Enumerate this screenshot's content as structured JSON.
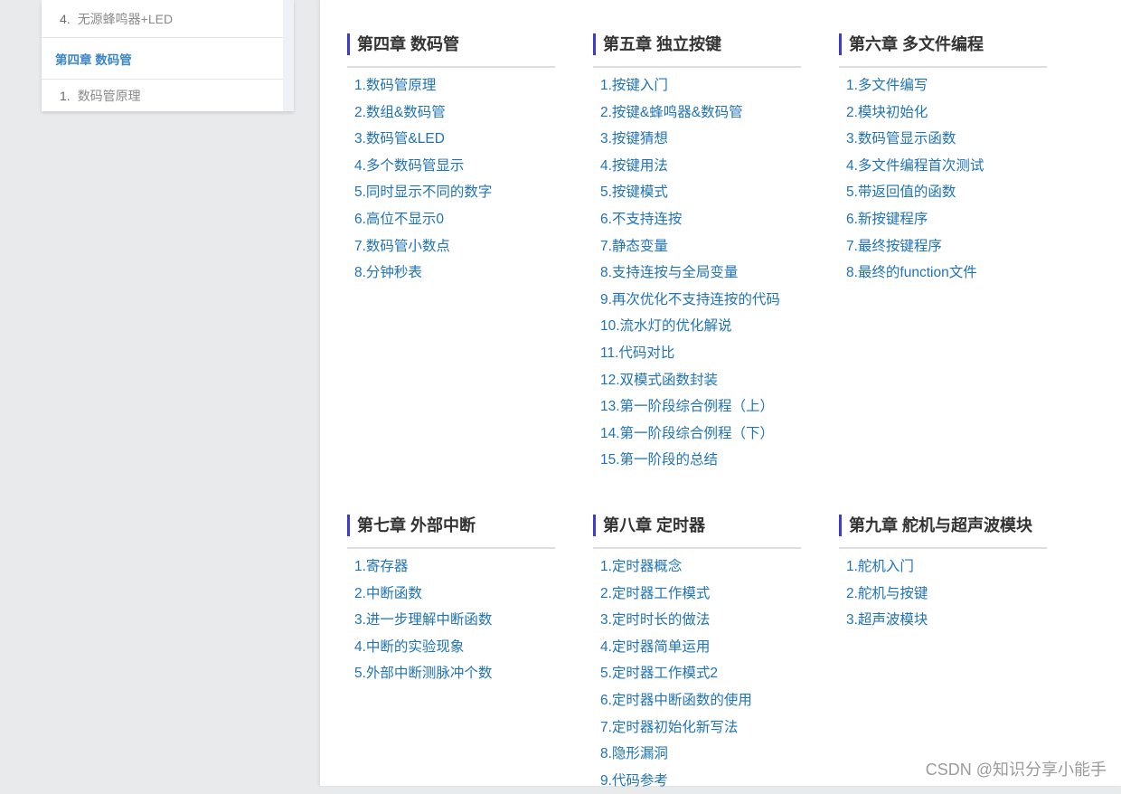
{
  "sidebar": {
    "items": [
      {
        "num": "4.",
        "label": "无源蜂鸣器+LED"
      },
      {
        "section": "第四章 数码管"
      },
      {
        "num": "1.",
        "label": "数码管原理"
      }
    ]
  },
  "chapters": [
    {
      "title": "第四章 数码管",
      "items": [
        "1.数码管原理",
        "2.数组&数码管",
        "3.数码管&LED",
        "4.多个数码管显示",
        "5.同时显示不同的数字",
        "6.高位不显示0",
        "7.数码管小数点",
        "8.分钟秒表"
      ]
    },
    {
      "title": "第五章 独立按键",
      "items": [
        "1.按键入门",
        "2.按键&蜂鸣器&数码管",
        "3.按键猜想",
        "4.按键用法",
        "5.按键模式",
        "6.不支持连按",
        "7.静态变量",
        "8.支持连按与全局变量",
        "9.再次优化不支持连按的代码",
        "10.流水灯的优化解说",
        "11.代码对比",
        "12.双模式函数封装",
        "13.第一阶段综合例程（上）",
        "14.第一阶段综合例程（下）",
        "15.第一阶段的总结"
      ]
    },
    {
      "title": "第六章 多文件编程",
      "items": [
        "1.多文件编写",
        "2.模块初始化",
        "3.数码管显示函数",
        "4.多文件编程首次测试",
        "5.带返回值的函数",
        "6.新按键程序",
        "7.最终按键程序",
        "8.最终的function文件"
      ]
    },
    {
      "title": "第七章 外部中断",
      "items": [
        "1.寄存器",
        "2.中断函数",
        "3.进一步理解中断函数",
        "4.中断的实验现象",
        "5.外部中断测脉冲个数"
      ]
    },
    {
      "title": "第八章 定时器",
      "items": [
        "1.定时器概念",
        "2.定时器工作模式",
        "3.定时时长的做法",
        "4.定时器简单运用",
        "5.定时器工作模式2",
        "6.定时器中断函数的使用",
        "7.定时器初始化新写法",
        "8.隐形漏洞",
        "9.代码参考"
      ]
    },
    {
      "title": "第九章 舵机与超声波模块",
      "items": [
        "1.舵机入门",
        "2.舵机与按键",
        "3.超声波模块"
      ]
    }
  ],
  "watermark": "CSDN @知识分享小能手",
  "colors": {
    "link": "#1f73b7",
    "accent_bar": "#3b3bd0",
    "sidebar_section": "#3a86c8"
  }
}
